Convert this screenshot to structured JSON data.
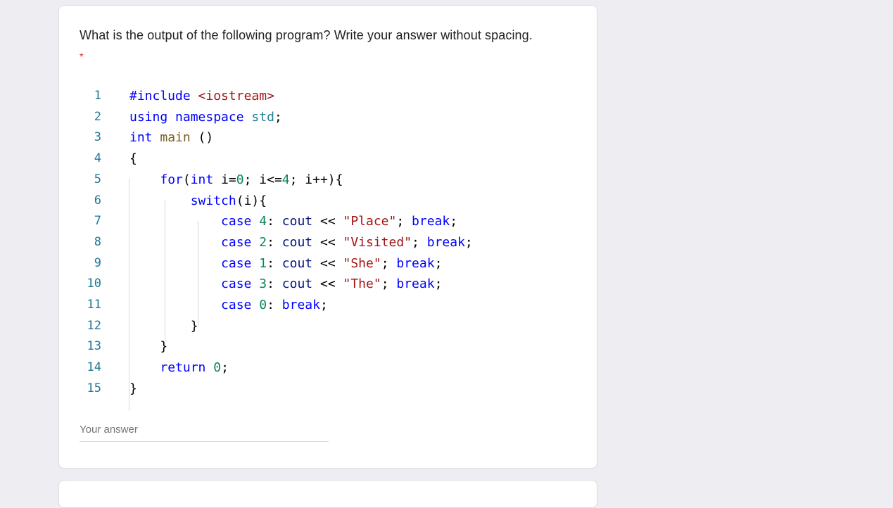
{
  "question": {
    "text": "What is the output of the following program? Write your answer without spacing.",
    "required_mark": "*"
  },
  "code": {
    "lines": [
      {
        "num": "1",
        "tokens": [
          {
            "t": "#include ",
            "c": "pp"
          },
          {
            "t": "<iostream>",
            "c": "inc"
          }
        ]
      },
      {
        "num": "2",
        "tokens": [
          {
            "t": "using",
            "c": "kw"
          },
          {
            "t": " ",
            "c": "pl"
          },
          {
            "t": "namespace",
            "c": "kw"
          },
          {
            "t": " ",
            "c": "pl"
          },
          {
            "t": "std",
            "c": "ns"
          },
          {
            "t": ";",
            "c": "pl"
          }
        ]
      },
      {
        "num": "3",
        "tokens": [
          {
            "t": "int",
            "c": "ty"
          },
          {
            "t": " ",
            "c": "pl"
          },
          {
            "t": "main",
            "c": "fn"
          },
          {
            "t": " ()",
            "c": "pl"
          }
        ]
      },
      {
        "num": "4",
        "tokens": [
          {
            "t": "{",
            "c": "pl"
          }
        ]
      },
      {
        "num": "5",
        "tokens": [
          {
            "t": "    ",
            "c": "pl"
          },
          {
            "t": "for",
            "c": "kw"
          },
          {
            "t": "(",
            "c": "pl"
          },
          {
            "t": "int",
            "c": "ty"
          },
          {
            "t": " i=",
            "c": "pl"
          },
          {
            "t": "0",
            "c": "nm"
          },
          {
            "t": "; i<=",
            "c": "pl"
          },
          {
            "t": "4",
            "c": "nm"
          },
          {
            "t": "; i++){",
            "c": "pl"
          }
        ]
      },
      {
        "num": "6",
        "tokens": [
          {
            "t": "        ",
            "c": "pl"
          },
          {
            "t": "switch",
            "c": "kw"
          },
          {
            "t": "(i){",
            "c": "pl"
          }
        ]
      },
      {
        "num": "7",
        "tokens": [
          {
            "t": "            ",
            "c": "pl"
          },
          {
            "t": "case",
            "c": "kw"
          },
          {
            "t": " ",
            "c": "pl"
          },
          {
            "t": "4",
            "c": "nm"
          },
          {
            "t": ": ",
            "c": "pl"
          },
          {
            "t": "cout",
            "c": "id"
          },
          {
            "t": " << ",
            "c": "pl"
          },
          {
            "t": "\"Place\"",
            "c": "st"
          },
          {
            "t": "; ",
            "c": "pl"
          },
          {
            "t": "break",
            "c": "kw"
          },
          {
            "t": ";",
            "c": "pl"
          }
        ]
      },
      {
        "num": "8",
        "tokens": [
          {
            "t": "            ",
            "c": "pl"
          },
          {
            "t": "case",
            "c": "kw"
          },
          {
            "t": " ",
            "c": "pl"
          },
          {
            "t": "2",
            "c": "nm"
          },
          {
            "t": ": ",
            "c": "pl"
          },
          {
            "t": "cout",
            "c": "id"
          },
          {
            "t": " << ",
            "c": "pl"
          },
          {
            "t": "\"Visited\"",
            "c": "st"
          },
          {
            "t": "; ",
            "c": "pl"
          },
          {
            "t": "break",
            "c": "kw"
          },
          {
            "t": ";",
            "c": "pl"
          }
        ]
      },
      {
        "num": "9",
        "tokens": [
          {
            "t": "            ",
            "c": "pl"
          },
          {
            "t": "case",
            "c": "kw"
          },
          {
            "t": " ",
            "c": "pl"
          },
          {
            "t": "1",
            "c": "nm"
          },
          {
            "t": ": ",
            "c": "pl"
          },
          {
            "t": "cout",
            "c": "id"
          },
          {
            "t": " << ",
            "c": "pl"
          },
          {
            "t": "\"She\"",
            "c": "st"
          },
          {
            "t": "; ",
            "c": "pl"
          },
          {
            "t": "break",
            "c": "kw"
          },
          {
            "t": ";",
            "c": "pl"
          }
        ]
      },
      {
        "num": "10",
        "tokens": [
          {
            "t": "            ",
            "c": "pl"
          },
          {
            "t": "case",
            "c": "kw"
          },
          {
            "t": " ",
            "c": "pl"
          },
          {
            "t": "3",
            "c": "nm"
          },
          {
            "t": ": ",
            "c": "pl"
          },
          {
            "t": "cout",
            "c": "id"
          },
          {
            "t": " << ",
            "c": "pl"
          },
          {
            "t": "\"The\"",
            "c": "st"
          },
          {
            "t": "; ",
            "c": "pl"
          },
          {
            "t": "break",
            "c": "kw"
          },
          {
            "t": ";",
            "c": "pl"
          }
        ]
      },
      {
        "num": "11",
        "tokens": [
          {
            "t": "            ",
            "c": "pl"
          },
          {
            "t": "case",
            "c": "kw"
          },
          {
            "t": " ",
            "c": "pl"
          },
          {
            "t": "0",
            "c": "nm"
          },
          {
            "t": ": ",
            "c": "pl"
          },
          {
            "t": "break",
            "c": "kw"
          },
          {
            "t": ";",
            "c": "pl"
          }
        ]
      },
      {
        "num": "12",
        "tokens": [
          {
            "t": "        }",
            "c": "pl"
          }
        ]
      },
      {
        "num": "13",
        "tokens": [
          {
            "t": "    }",
            "c": "pl"
          }
        ]
      },
      {
        "num": "14",
        "tokens": [
          {
            "t": "    ",
            "c": "pl"
          },
          {
            "t": "return",
            "c": "kw"
          },
          {
            "t": " ",
            "c": "pl"
          },
          {
            "t": "0",
            "c": "nm"
          },
          {
            "t": ";",
            "c": "pl"
          }
        ]
      },
      {
        "num": "15",
        "tokens": [
          {
            "t": "}",
            "c": "pl"
          }
        ]
      }
    ]
  },
  "answer": {
    "placeholder": "Your answer"
  }
}
